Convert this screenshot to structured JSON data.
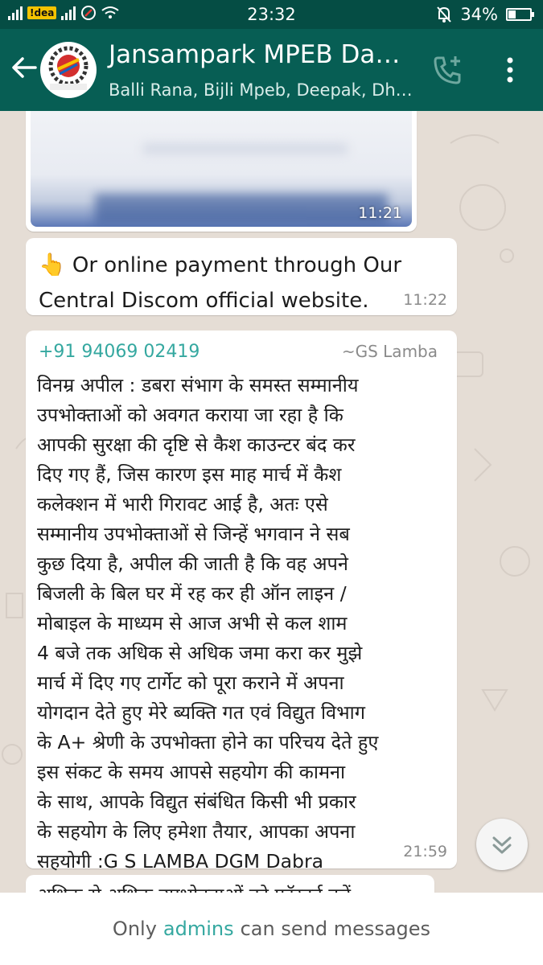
{
  "status_bar": {
    "carrier": "!dea",
    "time": "23:32",
    "battery": "34%",
    "battery_level": 0.34
  },
  "header": {
    "title": "Jansampark MPEB Da…",
    "subtitle": "Balli Rana, Bijli Mpeb, Deepak, Dh…",
    "icons": [
      "back-arrow-icon",
      "add-call-icon",
      "more-vert-icon"
    ]
  },
  "messages": [
    {
      "type": "image",
      "time": "11:21"
    },
    {
      "type": "text",
      "emoji": "👆",
      "line1": "Or online payment through Our",
      "line2": "Central Discom official website.",
      "time": "11:22"
    },
    {
      "type": "text",
      "phone": "+91 94069 02419",
      "sender": "~GS Lamba",
      "body": "विनम्र अपील : डबरा संभाग के समस्त सम्मानीय\nउपभोक्ताओं को अवगत कराया जा रहा है कि\nआपकी सुरक्षा की दृष्टि से कैश काउन्टर बंद कर\nदिए गए हैं, जिस कारण इस माह मार्च में कैश\nकलेक्शन में भारी गिरावट आई है, अतः एसे\nसम्मानीय उपभोक्ताओं से जिन्हें भगवान ने सब\nकुछ दिया है, अपील की जाती है कि वह अपने\nबिजली के बिल घर में रह कर ही ऑन लाइन /\nमोबाइल के माध्यम से आज अभी से कल शाम\n4 बजे तक अधिक से अधिक जमा करा कर मुझे\nमार्च में दिए गए टार्गेट को पूरा कराने में अपना\nयोगदान देते हुए मेरे ब्यक्ति गत एवं विद्युत विभाग\nके A+ श्रेणी के उपभोक्ता होने का परिचय देते हुए\nइस संकट के समय आपसे सहयोग की कामना\nके साथ, आपके विद्युत संबंधित किसी भी प्रकार\nके सहयोग के लिए  हमेशा तैयार, आपका अपना\nसहयोगी :G S LAMBA DGM Dabra",
      "time": "21:59"
    },
    {
      "type": "text",
      "partial": "अधिक से अधिक उपभोक्ताओं को फॉरवर्ड करें"
    }
  ],
  "footer": {
    "prefix": "Only",
    "highlight": "admins",
    "suffix": "can send messages"
  },
  "colors": {
    "header": "#075e54",
    "status_bar": "#054d44",
    "accent": "#35a8a0",
    "chat_bg": "#e5ddd5"
  }
}
